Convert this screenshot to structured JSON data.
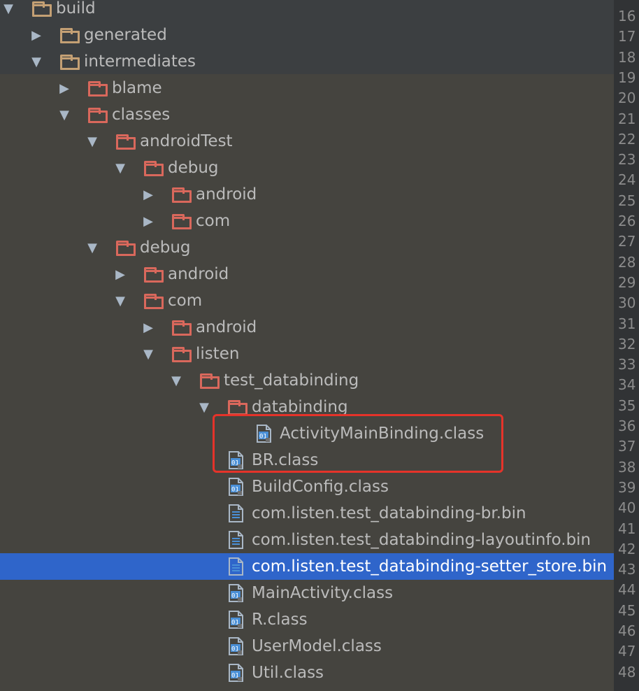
{
  "tree": {
    "items": [
      {
        "label": "build",
        "kind": "folder-tan",
        "state": "expanded",
        "depth": 0
      },
      {
        "label": "generated",
        "kind": "folder-tan",
        "state": "collapsed",
        "depth": 1
      },
      {
        "label": "intermediates",
        "kind": "folder-tan",
        "state": "expanded",
        "depth": 1
      },
      {
        "label": "blame",
        "kind": "folder-red",
        "state": "collapsed",
        "depth": 2
      },
      {
        "label": "classes",
        "kind": "folder-red",
        "state": "expanded",
        "depth": 2
      },
      {
        "label": "androidTest",
        "kind": "folder-red",
        "state": "expanded",
        "depth": 3
      },
      {
        "label": "debug",
        "kind": "folder-red",
        "state": "expanded",
        "depth": 4
      },
      {
        "label": "android",
        "kind": "folder-red",
        "state": "collapsed",
        "depth": 5
      },
      {
        "label": "com",
        "kind": "folder-red",
        "state": "collapsed",
        "depth": 5
      },
      {
        "label": "debug",
        "kind": "folder-red",
        "state": "expanded",
        "depth": 3
      },
      {
        "label": "android",
        "kind": "folder-red",
        "state": "collapsed",
        "depth": 4
      },
      {
        "label": "com",
        "kind": "folder-red",
        "state": "expanded",
        "depth": 4
      },
      {
        "label": "android",
        "kind": "folder-red",
        "state": "collapsed",
        "depth": 5
      },
      {
        "label": "listen",
        "kind": "folder-red",
        "state": "expanded",
        "depth": 5
      },
      {
        "label": "test_databinding",
        "kind": "folder-red",
        "state": "expanded",
        "depth": 6
      },
      {
        "label": "databinding",
        "kind": "folder-red",
        "state": "expanded",
        "depth": 7
      },
      {
        "label": "ActivityMainBinding.class",
        "kind": "class-file",
        "state": "leaf",
        "depth": 8
      },
      {
        "label": "BR.class",
        "kind": "class-file",
        "state": "leaf",
        "depth": 7
      },
      {
        "label": "BuildConfig.class",
        "kind": "class-file",
        "state": "leaf",
        "depth": 7
      },
      {
        "label": "com.listen.test_databinding-br.bin",
        "kind": "text-file",
        "state": "leaf",
        "depth": 7
      },
      {
        "label": "com.listen.test_databinding-layoutinfo.bin",
        "kind": "text-file",
        "state": "leaf",
        "depth": 7
      },
      {
        "label": "com.listen.test_databinding-setter_store.bin",
        "kind": "text-file",
        "state": "leaf",
        "depth": 7,
        "selected": true
      },
      {
        "label": "MainActivity.class",
        "kind": "class-file",
        "state": "leaf",
        "depth": 7
      },
      {
        "label": "R.class",
        "kind": "class-file",
        "state": "leaf",
        "depth": 7
      },
      {
        "label": "UserModel.class",
        "kind": "class-file",
        "state": "leaf",
        "depth": 7
      },
      {
        "label": "Util.class",
        "kind": "class-file",
        "state": "leaf",
        "depth": 7
      }
    ]
  },
  "gutter": {
    "lines": [
      "16",
      "17",
      "18",
      "19",
      "20",
      "21",
      "22",
      "23",
      "24",
      "25",
      "26",
      "27",
      "28",
      "29",
      "30",
      "31",
      "32",
      "33",
      "34",
      "35",
      "36",
      "37",
      "38",
      "39",
      "40",
      "41",
      "42",
      "43",
      "44",
      "45",
      "46",
      "47",
      "48"
    ]
  },
  "colors": {
    "folder_tan": "#C4A074",
    "folder_red": "#D9685C",
    "selection": "#2F65CA",
    "highlight_box": "#E5332A",
    "text": "#BBBBBB"
  }
}
